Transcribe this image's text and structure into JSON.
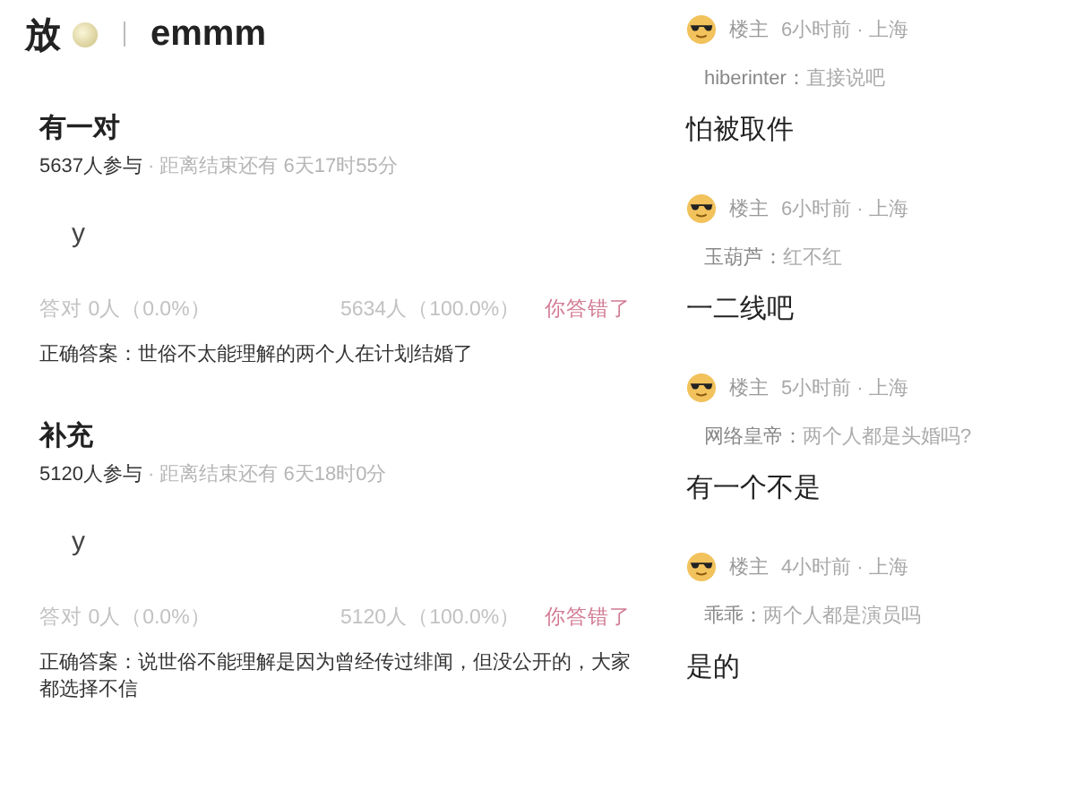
{
  "header": {
    "title": "放",
    "topic": "emmm"
  },
  "polls": [
    {
      "title": "有一对",
      "participants": "5637人参与",
      "deadline": "· 距离结束还有 6天17时55分",
      "option": "y",
      "correct_stat": "答对  0人（0.0%）",
      "wrong_stat": "5634人（100.0%）",
      "verdict": "你答错了",
      "answer": "正确答案：世俗不太能理解的两个人在计划结婚了"
    },
    {
      "title": "补充",
      "participants": "5120人参与",
      "deadline": "· 距离结束还有 6天18时0分",
      "option": "y",
      "correct_stat": "答对  0人（0.0%）",
      "wrong_stat": "5120人（100.0%）",
      "verdict": "你答错了",
      "answer": "正确答案：说世俗不能理解是因为曾经传过绯闻，但没公开的，大家都选择不信"
    }
  ],
  "comments": [
    {
      "author": "楼主",
      "time": "6小时前 · 上海",
      "quote_user": "hiberinter：",
      "quote_text": "直接说吧",
      "reply": "怕被取件"
    },
    {
      "author": "楼主",
      "time": "6小时前 · 上海",
      "quote_user": "玉葫芦：",
      "quote_text": "红不红",
      "reply": "一二线吧"
    },
    {
      "author": "楼主",
      "time": "5小时前 · 上海",
      "quote_user": "网络皇帝：",
      "quote_text": "两个人都是头婚吗?",
      "reply": "有一个不是"
    },
    {
      "author": "楼主",
      "time": "4小时前 · 上海",
      "quote_user": "乖乖：",
      "quote_text": "两个人都是演员吗",
      "reply": "是的"
    }
  ]
}
